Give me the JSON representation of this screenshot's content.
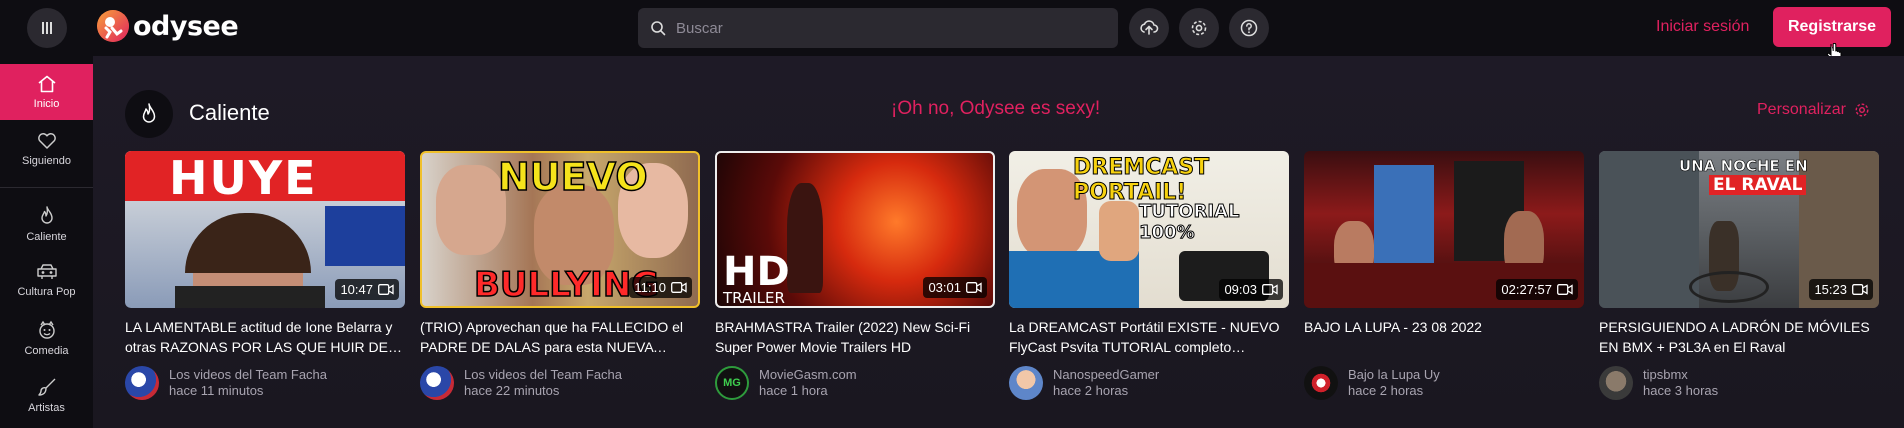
{
  "header": {
    "logo_text": "odysee",
    "search_placeholder": "Buscar",
    "login_label": "Iniciar sesión",
    "register_label": "Registrarse"
  },
  "sidebar": {
    "items": [
      {
        "label": "Inicio",
        "icon": "home-icon",
        "active": true
      },
      {
        "label": "Siguiendo",
        "icon": "heart-icon"
      },
      {
        "label": "Caliente",
        "icon": "flame-icon"
      },
      {
        "label": "Cultura Pop",
        "icon": "popculture-icon"
      },
      {
        "label": "Comedia",
        "icon": "comedy-icon"
      },
      {
        "label": "Artistas",
        "icon": "brush-icon"
      }
    ]
  },
  "category": {
    "title": "Caliente",
    "promo": "¡Oh no, Odysee es sexy!",
    "personalize": "Personalizar"
  },
  "thumb_text": {
    "v0": "HUYE",
    "v1_top": "NUEVO",
    "v1_bottom": "BULLYING",
    "v2_big": "HD",
    "v2_small": "TRAILER",
    "v3_top": "DREMCAST PORTAIL!",
    "v3_mid": "TUTORIAL 100%",
    "v5_top": "UNA NOCHE EN",
    "v5_mid": "EL RAVAL"
  },
  "videos": [
    {
      "title": "LA LAMENTABLE actitud de Ione Belarra y otras RAZONAS POR LAS QUE HUIR DE PODEMOS",
      "channel": "Los videos del Team Facha",
      "time": "hace 11 minutos",
      "duration": "10:47"
    },
    {
      "title": "(TRIO) Aprovechan que ha FALLECIDO el PADRE DE DALAS para esta NUEVA POLÉMICA",
      "channel": "Los videos del Team Facha",
      "time": "hace 22 minutos",
      "duration": "11:10"
    },
    {
      "title": "BRAHMASTRA Trailer (2022) New Sci-Fi Super Power Movie Trailers HD",
      "channel": "MovieGasm.com",
      "time": "hace 1 hora",
      "duration": "03:01"
    },
    {
      "title": "La DREAMCAST Portátil EXISTE - NUEVO FlyCast Psvita TUTORIAL completo magnífico",
      "channel": "NanospeedGamer",
      "time": "hace 2 horas",
      "duration": "09:03"
    },
    {
      "title": "BAJO LA LUPA - 23 08 2022",
      "channel": "Bajo la Lupa Uy",
      "time": "hace 2 horas",
      "duration": "02:27:57"
    },
    {
      "title": "PERSIGUIENDO A LADRÓN DE MÓVILES EN BMX + P3L3A en El Raval",
      "channel": "tipsbmx",
      "time": "hace 3 horas",
      "duration": "15:23"
    }
  ],
  "colors": {
    "accent": "#e0215f",
    "header_bg": "#0e0d12",
    "main_bg": "#1a1820"
  }
}
